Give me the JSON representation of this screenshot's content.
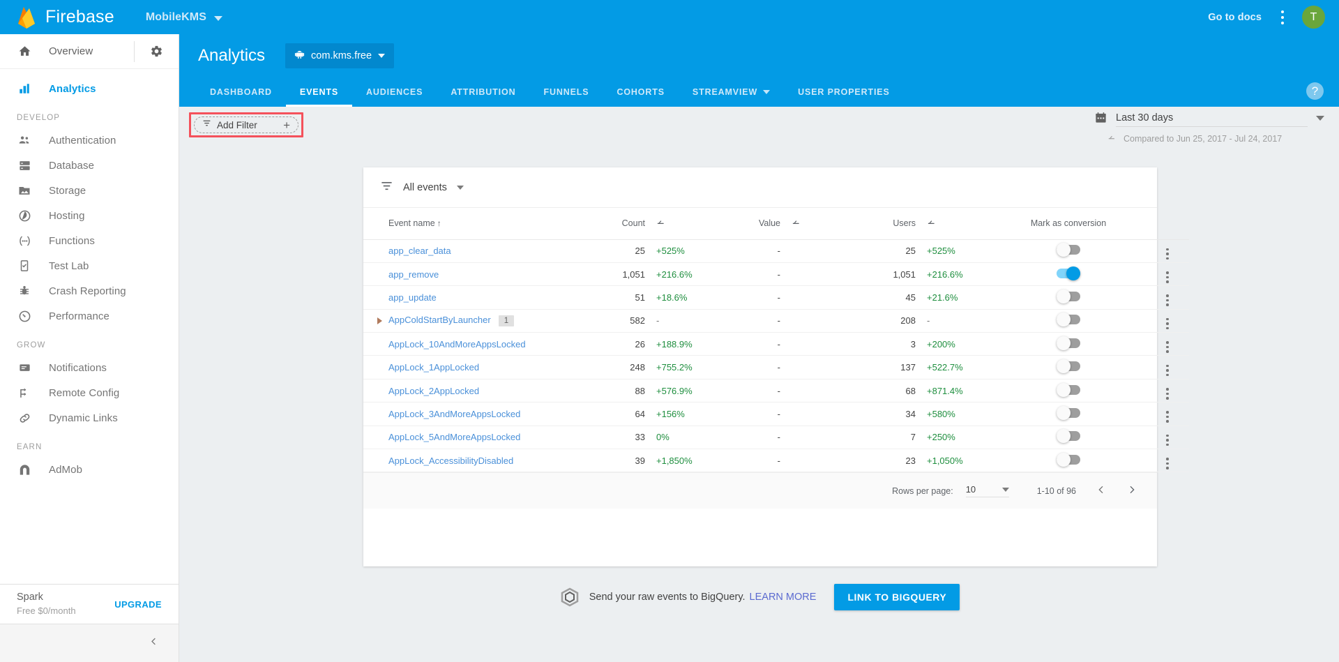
{
  "topbar": {
    "brand": "Firebase",
    "project_name": "MobileKMS",
    "go_to_docs": "Go to docs",
    "avatar_initial": "T",
    "background": "#039BE5"
  },
  "sidebar": {
    "overview": {
      "label": "Overview",
      "icon": "home-icon"
    },
    "settings_icon": "gear-icon",
    "items": [
      {
        "label": "Analytics",
        "icon": "analytics-icon",
        "active": true
      },
      {
        "label": "Authentication",
        "icon": "people-icon",
        "active": false
      },
      {
        "label": "Database",
        "icon": "database-icon",
        "active": false
      },
      {
        "label": "Storage",
        "icon": "storage-icon",
        "active": false
      },
      {
        "label": "Hosting",
        "icon": "hosting-globe-icon",
        "active": false
      },
      {
        "label": "Functions",
        "icon": "functions-icon",
        "active": false
      },
      {
        "label": "Test Lab",
        "icon": "test-lab-icon",
        "active": false
      },
      {
        "label": "Crash Reporting",
        "icon": "bug-icon",
        "active": false
      },
      {
        "label": "Performance",
        "icon": "performance-gauge-icon",
        "active": false
      },
      {
        "label": "Notifications",
        "icon": "notifications-icon",
        "active": false
      },
      {
        "label": "Remote Config",
        "icon": "remote-config-icon",
        "active": false
      },
      {
        "label": "Dynamic Links",
        "icon": "link-icon",
        "active": false
      },
      {
        "label": "AdMob",
        "icon": "admob-icon",
        "active": false
      }
    ],
    "sections": {
      "develop": "DEVELOP",
      "grow": "GROW",
      "earn": "EARN"
    },
    "plan": {
      "name": "Spark",
      "price": "Free $0/month",
      "upgrade": "UPGRADE"
    },
    "collapse_icon": "chevron-left-icon"
  },
  "analytics_header": {
    "title": "Analytics",
    "app_chip": {
      "label": "com.kms.free",
      "icon": "android-icon"
    },
    "tabs": [
      {
        "label": "DASHBOARD",
        "active": false,
        "has_caret": false
      },
      {
        "label": "EVENTS",
        "active": true,
        "has_caret": false
      },
      {
        "label": "AUDIENCES",
        "active": false,
        "has_caret": false
      },
      {
        "label": "ATTRIBUTION",
        "active": false,
        "has_caret": false
      },
      {
        "label": "FUNNELS",
        "active": false,
        "has_caret": false
      },
      {
        "label": "COHORTS",
        "active": false,
        "has_caret": false
      },
      {
        "label": "STREAMVIEW",
        "active": false,
        "has_caret": true
      },
      {
        "label": "USER PROPERTIES",
        "active": false,
        "has_caret": false
      }
    ],
    "help_icon": "help-question-icon"
  },
  "filter_strip": {
    "add_filter": {
      "label": "Add Filter",
      "plus": "+",
      "icon": "filter-icon",
      "highlight_color": "#F4515B"
    },
    "date_range": {
      "label": "Last 30 days",
      "compare_text": "Compared to Jun 25, 2017 - Jul 24, 2017",
      "calendar_icon": "calendar-icon",
      "compare_icon": "compare-arrow-icon"
    }
  },
  "events_card": {
    "filter_chip": {
      "label": "All events",
      "icon": "filter-list-icon"
    },
    "columns": {
      "event_name": "Event name",
      "event_name_sort": "↑",
      "count": "Count",
      "value": "Value",
      "users": "Users",
      "mark_as_conversion": "Mark as conversion"
    },
    "rows": [
      {
        "name": "app_clear_data",
        "count": "25",
        "count_delta": "+525%",
        "value": "-",
        "value_delta": "",
        "users": "25",
        "users_delta": "+525%",
        "conversion": false,
        "expandable": false,
        "badge": ""
      },
      {
        "name": "app_remove",
        "count": "1,051",
        "count_delta": "+216.6%",
        "value": "-",
        "value_delta": "",
        "users": "1,051",
        "users_delta": "+216.6%",
        "conversion": true,
        "expandable": false,
        "badge": ""
      },
      {
        "name": "app_update",
        "count": "51",
        "count_delta": "+18.6%",
        "value": "-",
        "value_delta": "",
        "users": "45",
        "users_delta": "+21.6%",
        "conversion": false,
        "expandable": false,
        "badge": ""
      },
      {
        "name": "AppColdStartByLauncher",
        "count": "582",
        "count_delta": "-",
        "value": "-",
        "value_delta": "",
        "users": "208",
        "users_delta": "-",
        "conversion": false,
        "expandable": true,
        "badge": "1"
      },
      {
        "name": "AppLock_10AndMoreAppsLocked",
        "count": "26",
        "count_delta": "+188.9%",
        "value": "-",
        "value_delta": "",
        "users": "3",
        "users_delta": "+200%",
        "conversion": false,
        "expandable": false,
        "badge": ""
      },
      {
        "name": "AppLock_1AppLocked",
        "count": "248",
        "count_delta": "+755.2%",
        "value": "-",
        "value_delta": "",
        "users": "137",
        "users_delta": "+522.7%",
        "conversion": false,
        "expandable": false,
        "badge": ""
      },
      {
        "name": "AppLock_2AppLocked",
        "count": "88",
        "count_delta": "+576.9%",
        "value": "-",
        "value_delta": "",
        "users": "68",
        "users_delta": "+871.4%",
        "conversion": false,
        "expandable": false,
        "badge": ""
      },
      {
        "name": "AppLock_3AndMoreAppsLocked",
        "count": "64",
        "count_delta": "+156%",
        "value": "-",
        "value_delta": "",
        "users": "34",
        "users_delta": "+580%",
        "conversion": false,
        "expandable": false,
        "badge": ""
      },
      {
        "name": "AppLock_5AndMoreAppsLocked",
        "count": "33",
        "count_delta": "0%",
        "value": "-",
        "value_delta": "",
        "users": "7",
        "users_delta": "+250%",
        "conversion": false,
        "expandable": false,
        "badge": ""
      },
      {
        "name": "AppLock_AccessibilityDisabled",
        "count": "39",
        "count_delta": "+1,850%",
        "value": "-",
        "value_delta": "",
        "users": "23",
        "users_delta": "+1,050%",
        "conversion": false,
        "expandable": false,
        "badge": ""
      }
    ],
    "pagination": {
      "rows_per_page_label": "Rows per page:",
      "rows_per_page_value": "10",
      "range": "1-10 of 96",
      "prev_icon": "chevron-left-icon",
      "next_icon": "chevron-right-icon"
    }
  },
  "bigquery": {
    "icon": "bigquery-hex-icon",
    "text": "Send your raw events to BigQuery.",
    "learn_more": "LEARN MORE",
    "button": "LINK TO BIGQUERY"
  },
  "colors": {
    "brand_blue": "#039BE5",
    "link_blue": "#4a90d9",
    "positive_green": "#1e8e3e",
    "highlight_red": "#F4515B",
    "avatar_green": "#6AA63B"
  }
}
